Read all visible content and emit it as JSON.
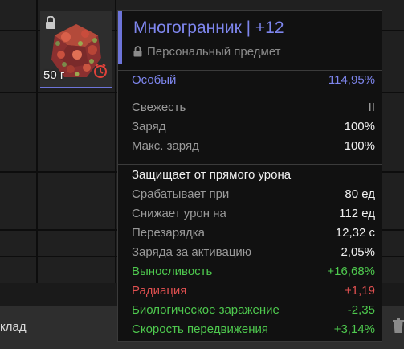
{
  "inventory": {
    "quantity_label": "50 г"
  },
  "tooltip": {
    "title": "Многогранник | +12",
    "subtitle": "Персональный предмет",
    "rarity": {
      "label": "Особый",
      "value": "114,95%"
    },
    "stats1": [
      {
        "label": "Свежесть",
        "value": "II"
      },
      {
        "label": "Заряд",
        "value": "100%"
      },
      {
        "label": "Макс. заряд",
        "value": "100%"
      }
    ],
    "effect_heading": "Защищает от прямого урона",
    "stats2": [
      {
        "label": "Срабатывает при",
        "value": "80 ед"
      },
      {
        "label": "Снижает урон на",
        "value": "112 ед"
      },
      {
        "label": "Перезарядка",
        "value": "12,32 с"
      },
      {
        "label": "Заряда за активацию",
        "value": "2,05%"
      }
    ],
    "modifiers": [
      {
        "label": "Выносливость",
        "value": "+16,68%",
        "tone": "green"
      },
      {
        "label": "Радиация",
        "value": "+1,19",
        "tone": "red"
      },
      {
        "label": "Биологическое заражение",
        "value": "-2,35",
        "tone": "green"
      },
      {
        "label": "Скорость передвижения",
        "value": "+3,14%",
        "tone": "green"
      }
    ]
  },
  "bottom": {
    "label": "клад"
  },
  "colors": {
    "accent": "#6d74d9",
    "positive": "#4ec94e",
    "negative": "#e05050"
  },
  "icons": [
    "lock-icon",
    "artifact-image",
    "timer-icon",
    "trash-icon"
  ]
}
